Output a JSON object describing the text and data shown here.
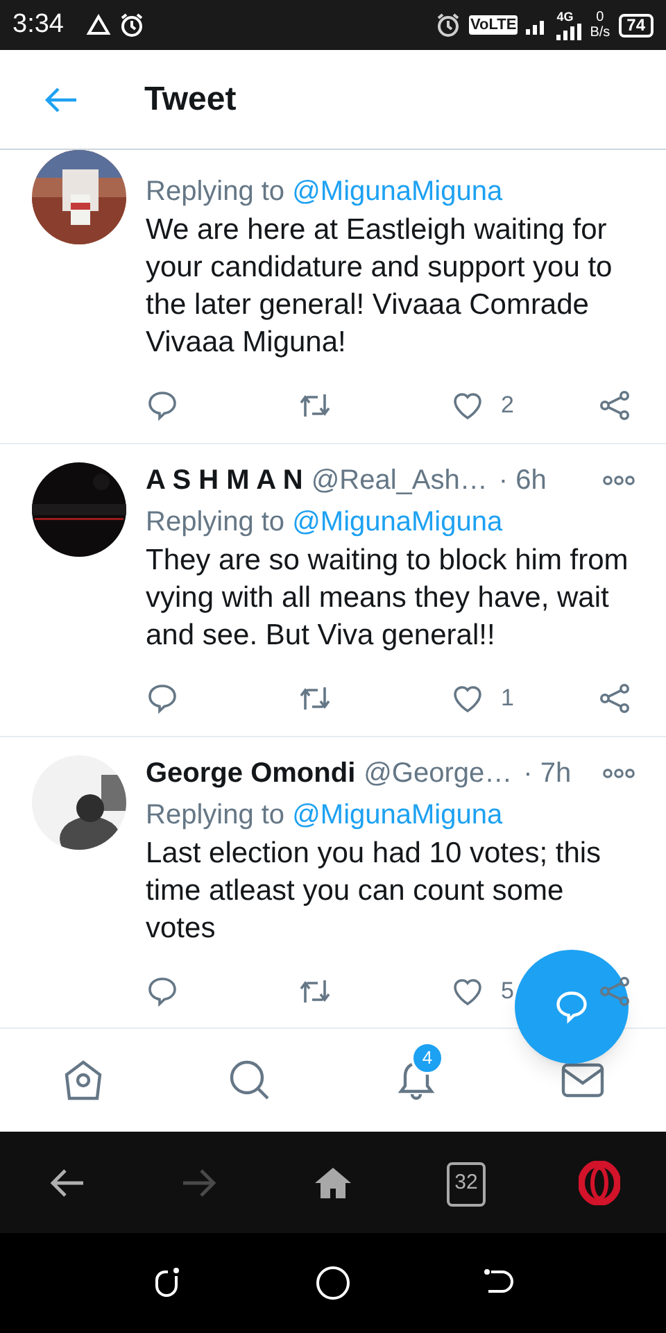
{
  "status_bar": {
    "time": "3:34",
    "network": "VoLTE",
    "network_type": "4G",
    "speed_value": "0",
    "speed_unit": "B/s",
    "battery": "74"
  },
  "header": {
    "title": "Tweet"
  },
  "tweets": [
    {
      "replying_label": "Replying to",
      "replying_handle": "@MigunaMiguna",
      "body": "We are here at Eastleigh waiting for your candidature and support you to the later general! Vivaaa Comrade Vivaaa Miguna!",
      "likes": "2"
    },
    {
      "name": "A S H M A N",
      "handle": "@Real_Ash…",
      "time": "· 6h",
      "replying_label": "Replying to",
      "replying_handle": "@MigunaMiguna",
      "body": "They are so waiting to block him from vying with all means they have, wait and see. But Viva general!!",
      "likes": "1"
    },
    {
      "name": "George Omondi",
      "handle": "@George…",
      "time": "· 7h",
      "replying_label": "Replying to",
      "replying_handle": "@MigunaMiguna",
      "body": "Last election you had 10 votes; this time atleast you can count some votes",
      "likes": "5"
    }
  ],
  "bottom_nav": {
    "notifications_badge": "4"
  },
  "browser_bar": {
    "tabs_count": "32"
  }
}
